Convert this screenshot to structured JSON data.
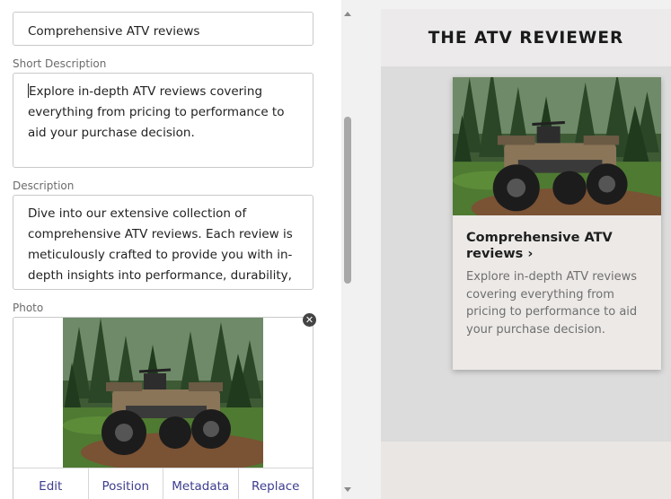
{
  "editor": {
    "title_value": "Comprehensive ATV reviews",
    "short_description": {
      "label": "Short Description",
      "value": "Explore in-depth ATV reviews covering everything from pricing to performance to aid your purchase decision."
    },
    "description": {
      "label": "Description",
      "value": "Dive into our extensive collection of comprehensive ATV reviews. Each review is meticulously crafted to provide you with in-depth insights into performance, durability, and"
    },
    "photo": {
      "label": "Photo",
      "remove_icon": "close-circle-icon",
      "actions": [
        "Edit",
        "Position",
        "Metadata",
        "Replace"
      ]
    }
  },
  "preview": {
    "site_title": "THE ATV REVIEWER",
    "card": {
      "title": "Comprehensive ATV reviews",
      "chevron": "›",
      "body": "Explore in-depth ATV reviews covering everything from pricing to performance to aid your purchase decision."
    }
  },
  "colors": {
    "action_link": "#3d3d8f",
    "preview_bg": "#dcdcdc",
    "card_bg": "#ece9e7"
  }
}
